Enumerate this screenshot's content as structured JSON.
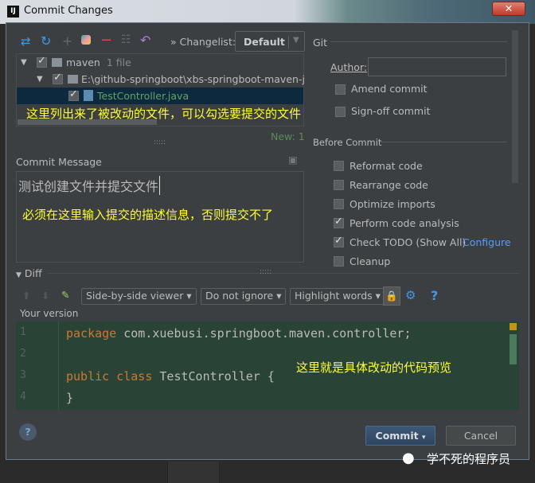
{
  "window": {
    "title": "Commit Changes",
    "logo": "IJ",
    "close_icon": "close-icon"
  },
  "toolbar": {
    "changelist_label": "Changelist:",
    "changelist_value": "Default"
  },
  "tree": [
    {
      "label": "maven",
      "extra": "1 file",
      "checked": true
    },
    {
      "label": "E:\\github-springboot\\xbs-springboot-maven-jar",
      "checked": true
    },
    {
      "label": "TestController.java",
      "checked": true,
      "selected": true
    }
  ],
  "annotations": {
    "files": "这里列出来了被改动的文件，可以勾选要提交的文件",
    "message": "必须在这里输入提交的描述信息，否则提交不了",
    "diff": "这里就是具体改动的代码预览"
  },
  "new_count": "New: 1",
  "commit_message": {
    "label": "Commit Message",
    "value": "测试创建文件并提交文件"
  },
  "git": {
    "title": "Git",
    "author_label": "Author:",
    "author_value": "",
    "amend": "Amend commit",
    "signoff": "Sign-off commit"
  },
  "before_commit": {
    "title": "Before Commit",
    "items": [
      {
        "label": "Reformat code",
        "checked": false
      },
      {
        "label": "Rearrange code",
        "checked": false
      },
      {
        "label": "Optimize imports",
        "checked": false
      },
      {
        "label": "Perform code analysis",
        "checked": true
      },
      {
        "label": "Check TODO (Show All)",
        "checked": true,
        "link": "Configure"
      },
      {
        "label": "Cleanup",
        "checked": false
      }
    ]
  },
  "diff": {
    "title": "Diff",
    "viewer": "Side-by-side viewer",
    "ignore": "Do not ignore",
    "highlight": "Highlight words",
    "version_label": "Your version",
    "lines": [
      {
        "n": "1",
        "kw": "package",
        "rest": " com.xuebusi.springboot.maven.controller;"
      },
      {
        "n": "2",
        "kw": "",
        "rest": ""
      },
      {
        "n": "3",
        "kw": "public class",
        "rest": " TestController {"
      },
      {
        "n": "4",
        "kw": "",
        "rest": "}"
      }
    ]
  },
  "buttons": {
    "commit": "Commit",
    "cancel": "Cancel",
    "help": "?"
  },
  "watermark": "学不死的程序员",
  "colors": {
    "accent": "#589df6",
    "diff_bg": "#294436",
    "keyword": "#cc7832",
    "selection": "#0d293e"
  }
}
